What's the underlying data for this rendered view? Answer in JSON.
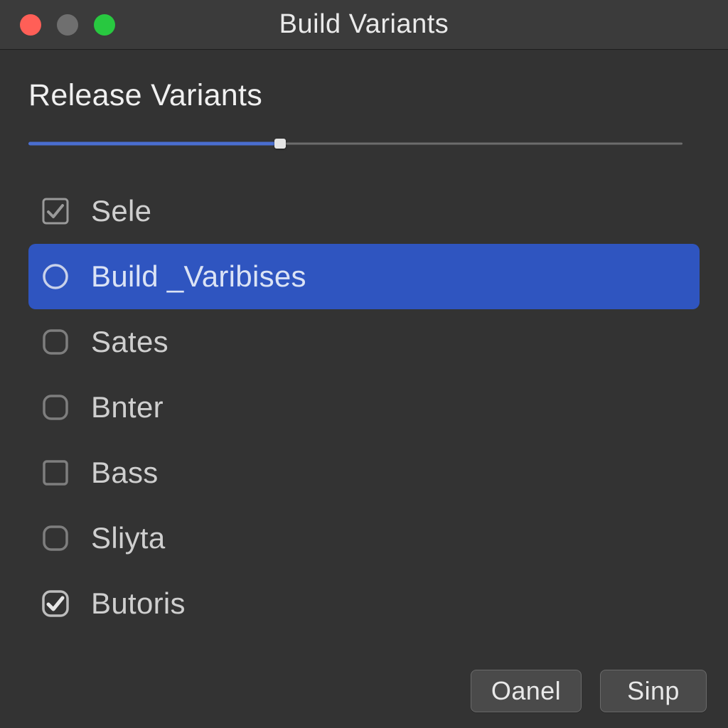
{
  "window": {
    "title": "Build Variants"
  },
  "section": {
    "title": "Release Variants"
  },
  "slider": {
    "percent": 38.5
  },
  "variants": {
    "items": [
      {
        "label": "Sele",
        "shape": "square",
        "checked": true,
        "selected": false
      },
      {
        "label": "Build _Varibises",
        "shape": "circle",
        "checked": false,
        "selected": true
      },
      {
        "label": "Sates",
        "shape": "round",
        "checked": false,
        "selected": false
      },
      {
        "label": "Bnter",
        "shape": "round",
        "checked": false,
        "selected": false
      },
      {
        "label": "Bass",
        "shape": "square",
        "checked": false,
        "selected": false
      },
      {
        "label": "Sliyta",
        "shape": "round",
        "checked": false,
        "selected": false
      },
      {
        "label": "Butoris",
        "shape": "round",
        "checked": true,
        "selected": false
      }
    ]
  },
  "footer": {
    "cancel_label": "Oanel",
    "ok_label": "Sinp"
  },
  "colors": {
    "accent": "#2f55c0",
    "slider_fill": "#4a6ed0",
    "bg": "#333333"
  }
}
